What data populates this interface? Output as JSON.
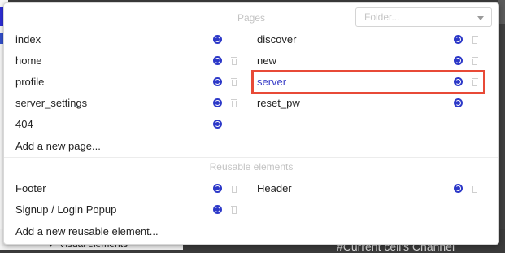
{
  "background": {
    "sidebar_item": "Visual elements",
    "right_text": "#Current cell's Channel"
  },
  "folder_select": {
    "placeholder": "Folder..."
  },
  "pages": {
    "title": "Pages",
    "left": [
      {
        "label": "index"
      },
      {
        "label": "home"
      },
      {
        "label": "profile"
      },
      {
        "label": "server_settings"
      },
      {
        "label": "404"
      }
    ],
    "right": [
      {
        "label": "discover"
      },
      {
        "label": "new"
      },
      {
        "label": "server"
      },
      {
        "label": "reset_pw"
      }
    ],
    "add_label": "Add a new page..."
  },
  "reusable": {
    "title": "Reusable elements",
    "left": [
      {
        "label": "Footer"
      },
      {
        "label": "Signup / Login Popup"
      }
    ],
    "right": [
      {
        "label": "Header"
      }
    ],
    "add_label": "Add a new reusable element..."
  },
  "colors": {
    "accent": "#2c38c8",
    "highlight": "#e84a37"
  },
  "icons": {
    "cycle": "convert-cycle-icon",
    "delete": "trash-icon"
  }
}
